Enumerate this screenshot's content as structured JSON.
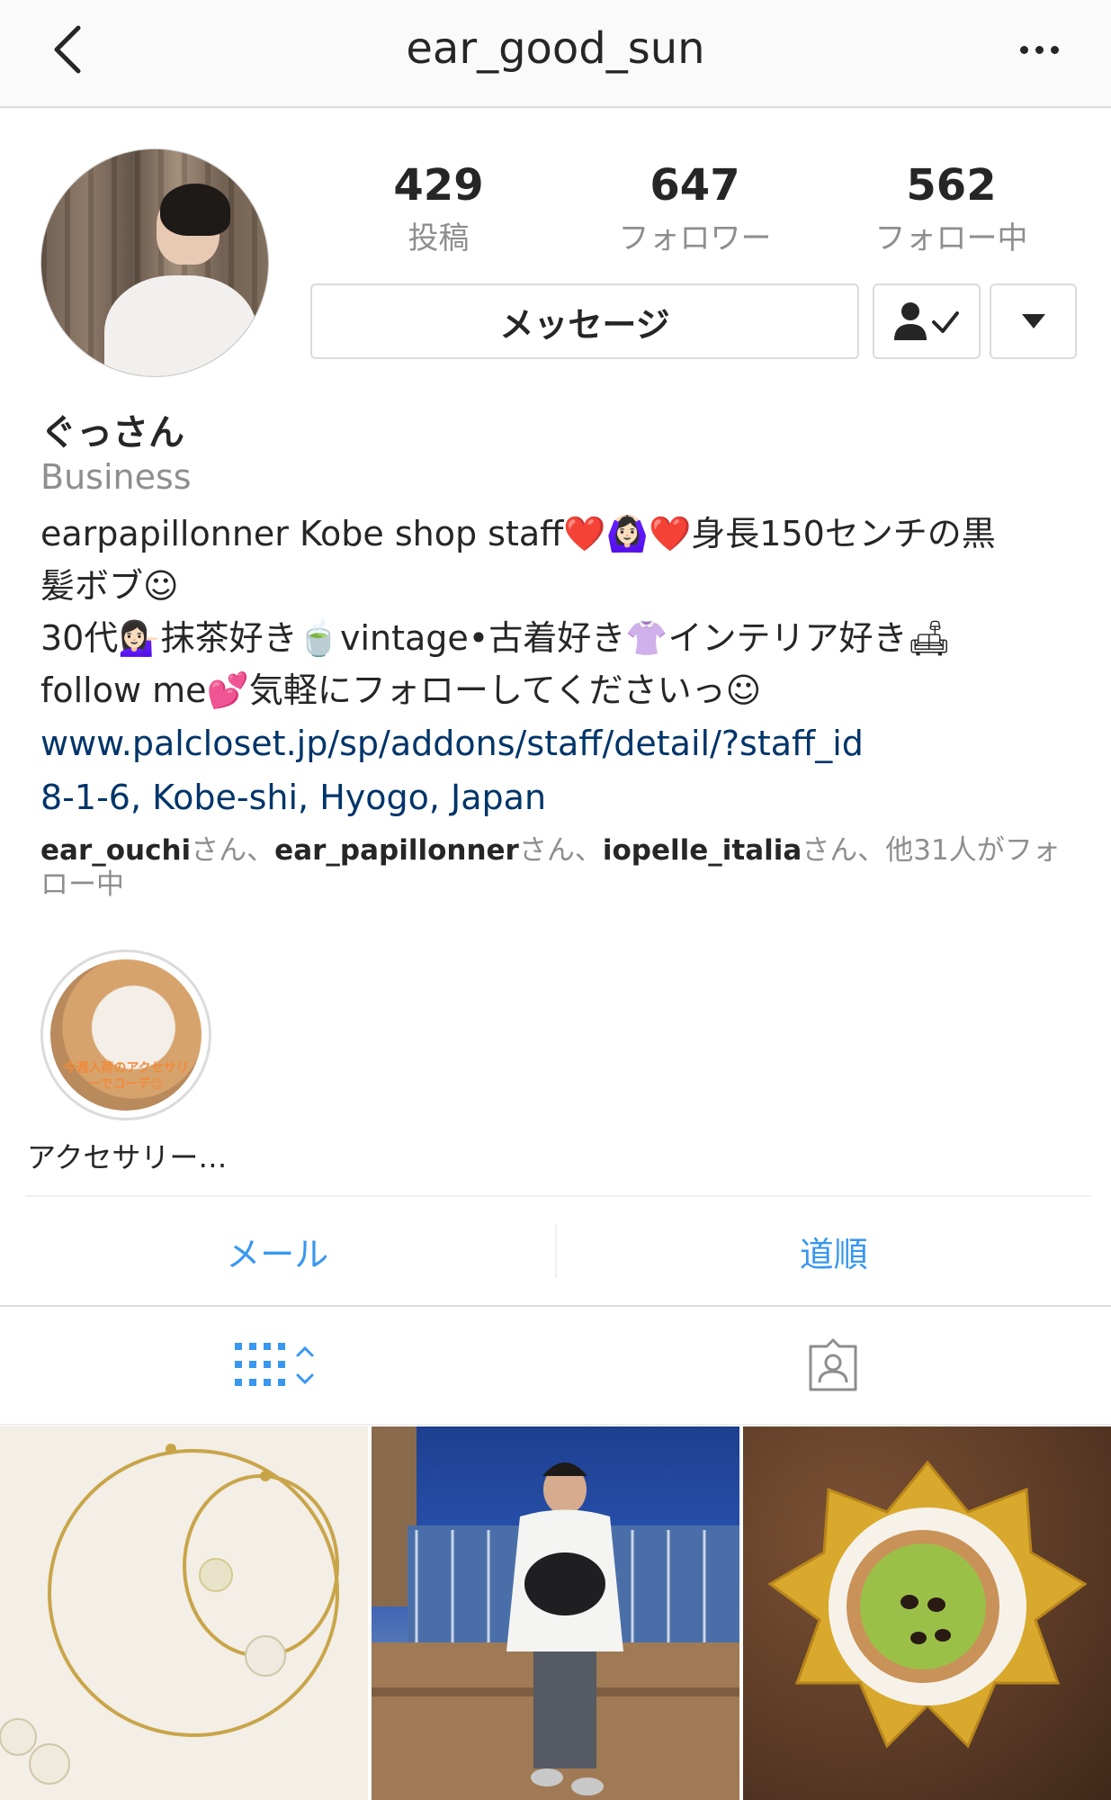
{
  "nav": {
    "title": "ear_good_sun",
    "back_icon": "chevron-left-icon",
    "more_icon": "more-horizontal-icon"
  },
  "profile": {
    "stats": [
      {
        "value": "429",
        "label": "投稿"
      },
      {
        "value": "647",
        "label": "フォロワー"
      },
      {
        "value": "562",
        "label": "フォロー中"
      }
    ],
    "message_button": "メッセージ",
    "following_icon": "person-check-icon",
    "dropdown_icon": "triangle-down-icon"
  },
  "bio": {
    "name": "ぐっさん",
    "category": "Business",
    "line1": "earpapillonner Kobe shop staff❤️🙆🏻‍♀️❤️身長150センチの黒",
    "line2": "髪ボブ☺︎",
    "line3": "30代💁🏻‍♀️抹茶好き🍵vintage•古着好き👚インテリア好き🛋",
    "line4": "follow me💕気軽にフォローしてくださいっ☺︎",
    "website": "www.palcloset.jp/sp/addons/staff/detail/?staff_id",
    "address": "8-1-6, Kobe-shi, Hyogo, Japan",
    "followed_by": {
      "user1": "ear_ouchi",
      "sep1": "さん、",
      "user2": "ear_papillonner",
      "sep2": "さん、",
      "user3": "iopelle_italia",
      "rest": "さん、他31人がフォロー中"
    }
  },
  "highlight": {
    "label": "アクセサリー…",
    "image_text": "今週入荷のアクセサリーでコーデ☺"
  },
  "actions": {
    "email": "メール",
    "directions": "道順"
  },
  "tabs": {
    "grid_icon": "grid-icon",
    "tagged_icon": "tagged-person-icon"
  },
  "colors": {
    "link": "#003569",
    "action_blue": "#3897f0",
    "secondary_text": "#8e8e8e",
    "border": "#dbdbdb"
  }
}
